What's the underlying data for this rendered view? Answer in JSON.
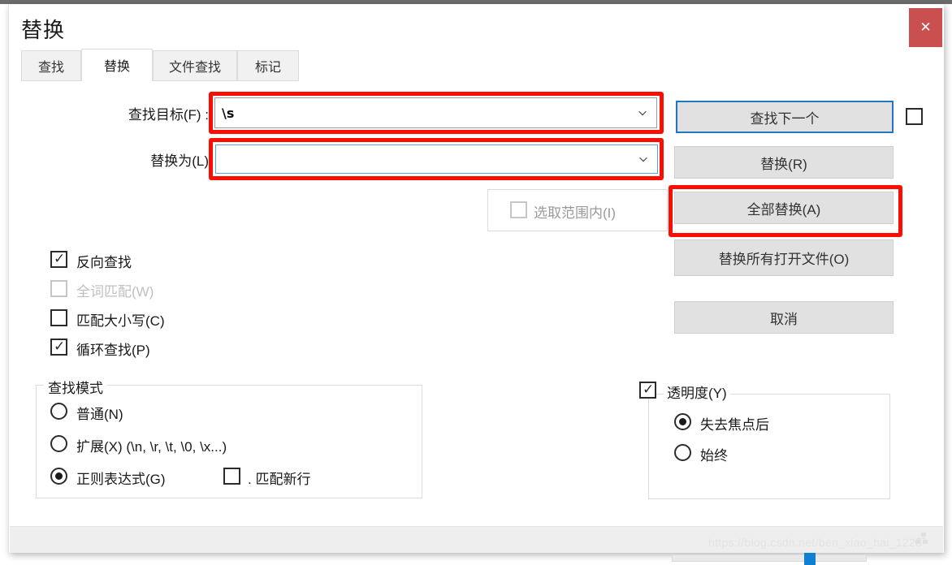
{
  "dialog": {
    "title": "替换",
    "close_label": "✕"
  },
  "tabs": [
    {
      "label": "查找",
      "active": false
    },
    {
      "label": "替换",
      "active": true
    },
    {
      "label": "文件查找",
      "active": false
    },
    {
      "label": "标记",
      "active": false
    }
  ],
  "fields": {
    "find_label": "查找目标(F) :",
    "find_value": "\\s",
    "replace_label": "替换为(L)",
    "replace_value": ""
  },
  "in_selection": {
    "label": "选取范围内(I)",
    "checked": false,
    "disabled": true
  },
  "buttons": {
    "find_next": "查找下一个",
    "replace": "替换(R)",
    "replace_all": "全部替换(A)",
    "replace_all_open": "替换所有打开文件(O)",
    "cancel": "取消"
  },
  "side_checkbox": {
    "label": "",
    "checked": false
  },
  "options": [
    {
      "label": "反向查找",
      "checked": true,
      "disabled": false
    },
    {
      "label": "全词匹配(W)",
      "checked": false,
      "disabled": true
    },
    {
      "label": "匹配大小写(C)",
      "checked": false,
      "disabled": false
    },
    {
      "label": "循环查找(P)",
      "checked": true,
      "disabled": false
    }
  ],
  "search_mode": {
    "title": "查找模式",
    "radios": [
      {
        "label": "普通(N)",
        "selected": false
      },
      {
        "label": "扩展(X) (\\n, \\r, \\t, \\0, \\x...)",
        "selected": false
      },
      {
        "label": "正则表达式(G)",
        "selected": true
      }
    ],
    "dot_matches_newline": {
      "label": ". 匹配新行",
      "checked": false
    }
  },
  "transparency": {
    "label": "透明度(Y)",
    "checked": true,
    "radios": [
      {
        "label": "失去焦点后",
        "selected": true
      },
      {
        "label": "始终",
        "selected": false
      }
    ],
    "slider_percent": 68
  },
  "watermark": {
    "text": "https://blog.csdn.net/ben_xiao_hai_1223"
  },
  "colors": {
    "highlight": "#fb0d02",
    "close": "#c9504f",
    "focus": "#1f77c4",
    "slider": "#0f7fd4"
  }
}
